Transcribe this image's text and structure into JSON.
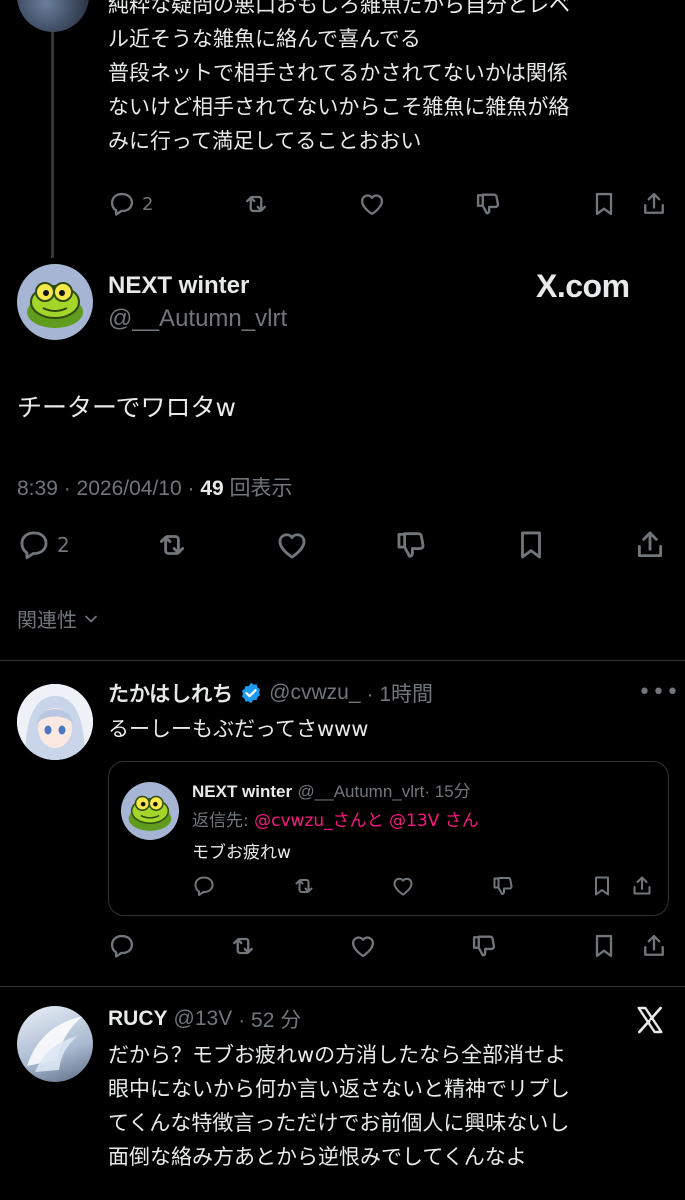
{
  "top_post": {
    "lines": [
      "純粋な疑問の悪口おもしろ雑魚だから自分とレベ",
      "ル近そうな雑魚に絡んで喜んでる",
      "普段ネットで相手されてるかされてないかは関係",
      "ないけど相手されてないからこそ雑魚に雑魚が絡",
      "みに行って満足してることおおい"
    ],
    "reply_count": "2"
  },
  "main_post": {
    "name": "NEXT winter",
    "handle": "@__Autumn_vlrt",
    "watermark": "X.com",
    "text": "チーターでワロタw",
    "time": "8:39 · 2026/04/10 · ",
    "views": "49",
    "views_label": " 回表示",
    "reply_count": "2"
  },
  "relevance_label": "関連性",
  "reply1": {
    "name": "たかはしれち",
    "handle": "@cvwzu_",
    "time": "· 1時間",
    "text": "るーしーもぶだってさwww",
    "more": "•••",
    "quote": {
      "name": "NEXT winter",
      "handle": "@__Autumn_vlrt",
      "time": "· 15分",
      "reply_prefix": "返信先: ",
      "reply_mentions": "@cvwzu_さんと @13V さん",
      "text": "モブお疲れw"
    }
  },
  "reply2": {
    "name": "RUCY",
    "handle": "@13V",
    "time": "· 52 分",
    "lines": [
      "だから？モブお疲れwの方消したなら全部消せよ",
      "眼中にないから何か言い返さないと精神でリプし",
      "てくんな特徴言っただけでお前個人に興味ないし",
      "面倒な絡み方あとから逆恨みでしてくんなよ"
    ]
  },
  "colors": {
    "background": "#000000",
    "text": "#e7e9ea",
    "secondary": "#71767b",
    "verified": "#1d9bf0",
    "mention": "#f91880",
    "divider": "#2f3336"
  }
}
